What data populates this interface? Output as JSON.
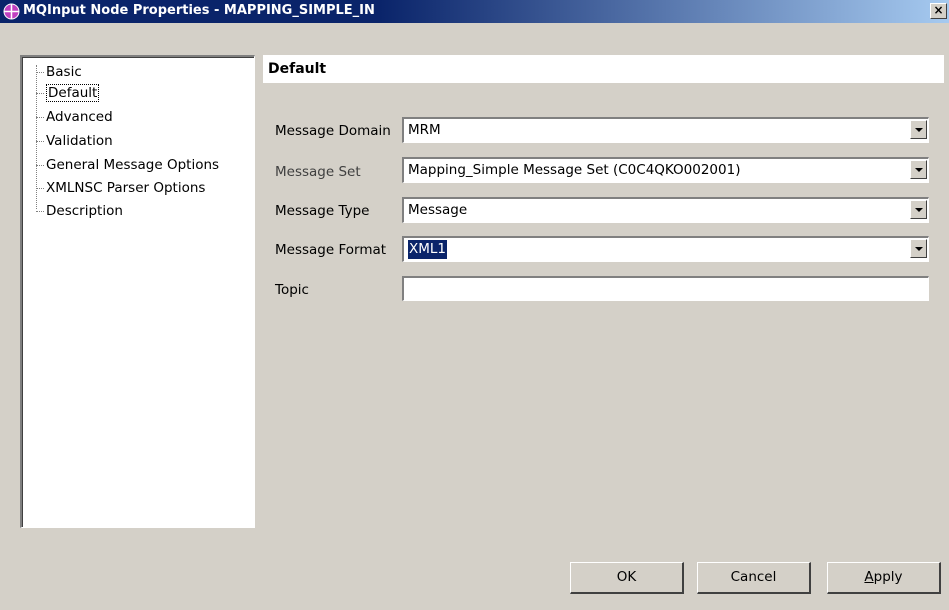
{
  "window": {
    "title": "MQInput Node Properties - MAPPING_SIMPLE_IN",
    "icon": "node-properties-icon",
    "close_label": "×"
  },
  "tree": {
    "items": [
      {
        "label": "Basic",
        "selected": false
      },
      {
        "label": "Default",
        "selected": true
      },
      {
        "label": "Advanced",
        "selected": false
      },
      {
        "label": "Validation",
        "selected": false
      },
      {
        "label": "General Message Options",
        "selected": false
      },
      {
        "label": "XMLNSC Parser Options",
        "selected": false
      },
      {
        "label": "Description",
        "selected": false
      }
    ]
  },
  "section": {
    "title": "Default"
  },
  "form": {
    "message_domain": {
      "label": "Message Domain",
      "value": "MRM"
    },
    "message_set": {
      "label": "Message Set",
      "value": "Mapping_Simple Message Set (C0C4QKO002001)"
    },
    "message_type": {
      "label": "Message Type",
      "value": "Message"
    },
    "message_format": {
      "label": "Message Format",
      "value": "XML1"
    },
    "topic": {
      "label": "Topic",
      "value": ""
    }
  },
  "buttons": {
    "ok": "OK",
    "cancel": "Cancel",
    "apply_mnemonic": "A",
    "apply_rest": "pply"
  },
  "colors": {
    "titlebar": "#0a246a",
    "selection": "#0a246a",
    "dialog_bg": "#d4d0c8"
  }
}
